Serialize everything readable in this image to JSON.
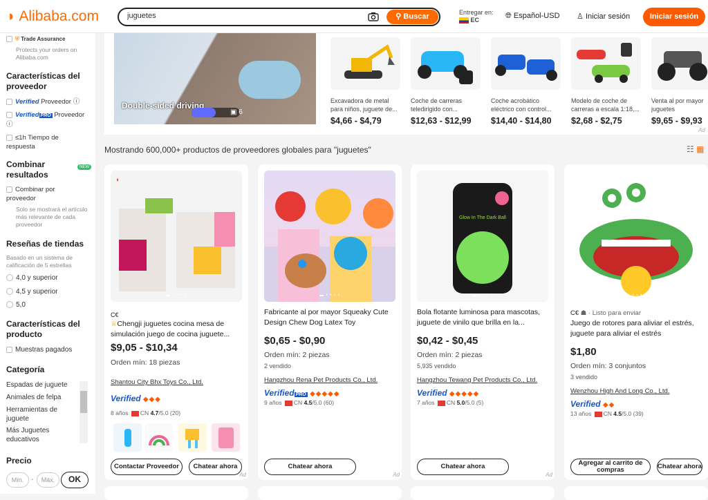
{
  "header": {
    "logo": "Alibaba.com",
    "search_value": "juguetes",
    "search_btn": "Buscar",
    "deliver_label": "Entregar en:",
    "deliver_country": "EC",
    "language": "Español-USD",
    "login": "Iniciar sesión",
    "signup": "Iniciar sesión"
  },
  "sidebar": {
    "trade_assurance": "Trade Assurance",
    "trade_desc": "Protects your orders on Alibaba.com",
    "supplier_title": "Características del proveedor",
    "verified": "Verified",
    "verified_suffix": "Proveedor",
    "pro": "PRO",
    "verified_pro_suffix": "Proveedor",
    "response": "≤1h Tiempo de respuesta",
    "merge_title": "Combinar resultados",
    "new_badge": "NEW",
    "merge_option": "Combinar por proveedor",
    "merge_desc": "Solo se mostrará el artículo más relevante de cada proveedor",
    "reviews_title": "Reseñas de tiendas",
    "reviews_desc": "Basado en un sistema de calificación de 5 estrellas",
    "rating_options": [
      "4,0 y superior",
      "4,5 y superior",
      "5,0"
    ],
    "product_title": "Características del producto",
    "samples": "Muestras pagados",
    "category_title": "Categoría",
    "categories": [
      "Espadas de juguete",
      "Animales de felpa",
      "Herramientas de juguete",
      "Más Juguetes educativos"
    ],
    "price_title": "Precio",
    "min_placeholder": "Mín.",
    "max_placeholder": "Máx.",
    "ok": "OK"
  },
  "strip": {
    "video_text": "Double-sided driving",
    "video_count": "6",
    "items": [
      {
        "name": "Excavadora de metal para niños, juguete de...",
        "price": "$4,66 - $4,79"
      },
      {
        "name": "Coche de carreras teledirigido con...",
        "price": "$12,63 - $12,99"
      },
      {
        "name": "Coche acrobático eléctrico con control...",
        "price": "$14,40 - $14,80"
      },
      {
        "name": "Modelo de coche de carreras a escala 1:18,...",
        "price": "$2,68 - $2,75"
      },
      {
        "name": "Venta al por mayor juguetes electrónicos",
        "price": "$9,65 - $9,93"
      }
    ],
    "ad": "Ad"
  },
  "results": {
    "showing": "Mostrando 600,000+ productos de proveedores globales para \"juguetes\""
  },
  "products": [
    {
      "badge": "C€",
      "crown": "♕",
      "title": "Chengji juguetes cocina mesa de simulación juego de cocina juguete...",
      "price": "$9,05 - $10,34",
      "moq": "Orden mín: 18 piezas",
      "sold": "",
      "supplier": "Shantou City Bhx Toys Co., Ltd.",
      "verified": "Verified",
      "pro": "",
      "years": "8 años",
      "country": "CN",
      "rating": "4.7",
      "rating_rest": "/5.0 (20)",
      "btn1": "Contactar Proveedor",
      "btn2": "Chatear ahora",
      "ad": "Ad"
    },
    {
      "badge": "",
      "crown": "",
      "title": "Fabricante al por mayor Squeaky Cute Design Chew Dog Latex Toy",
      "price": "$0,65 - $0,90",
      "moq": "Orden mín: 2 piezas",
      "sold": "2 vendido",
      "supplier": "Hangzhou Rena Pet Products Co., Ltd.",
      "verified": "Verified",
      "pro": "PRO",
      "years": "9 años",
      "country": "CN",
      "rating": "4.5",
      "rating_rest": "/5.0 (60)",
      "btn1": "Chatear ahora",
      "btn2": "",
      "ad": "Ad"
    },
    {
      "badge": "",
      "crown": "",
      "title": "Bola flotante luminosa para mascotas, juguete de vinilo que brilla en la...",
      "price": "$0,42 - $0,45",
      "moq": "Orden mín: 2 piezas",
      "sold": "5,935 vendido",
      "supplier": "Hangzhou Tewang Pet Products Co., Ltd.",
      "verified": "Verified",
      "pro": "",
      "years": "7 años",
      "country": "CN",
      "rating": "5.0",
      "rating_rest": "/5.0 (5)",
      "btn1": "Chatear ahora",
      "btn2": "",
      "ad": "Ad"
    },
    {
      "badge": "C€",
      "crown": "",
      "ready": "· Listo para enviar",
      "title": "Juego de rotores para aliviar el estrés, juguete para aliviar el estrés",
      "price": "$1,80",
      "moq": "Orden mín: 3 conjuntos",
      "sold": "3 vendido",
      "supplier": "Wenzhou High And Long Co., Ltd.",
      "verified": "Verified",
      "pro": "",
      "years": "13 años",
      "country": "CN",
      "rating": "4.5",
      "rating_rest": "/5.0 (39)",
      "btn1": "Agregar al carrito de compras",
      "btn2": "Chatear ahora",
      "ad": "Ad"
    }
  ],
  "ball_label": "Glow In The Dark Ball",
  "colors": {
    "accent": "#ff6a00",
    "verified": "#1a56c8"
  }
}
